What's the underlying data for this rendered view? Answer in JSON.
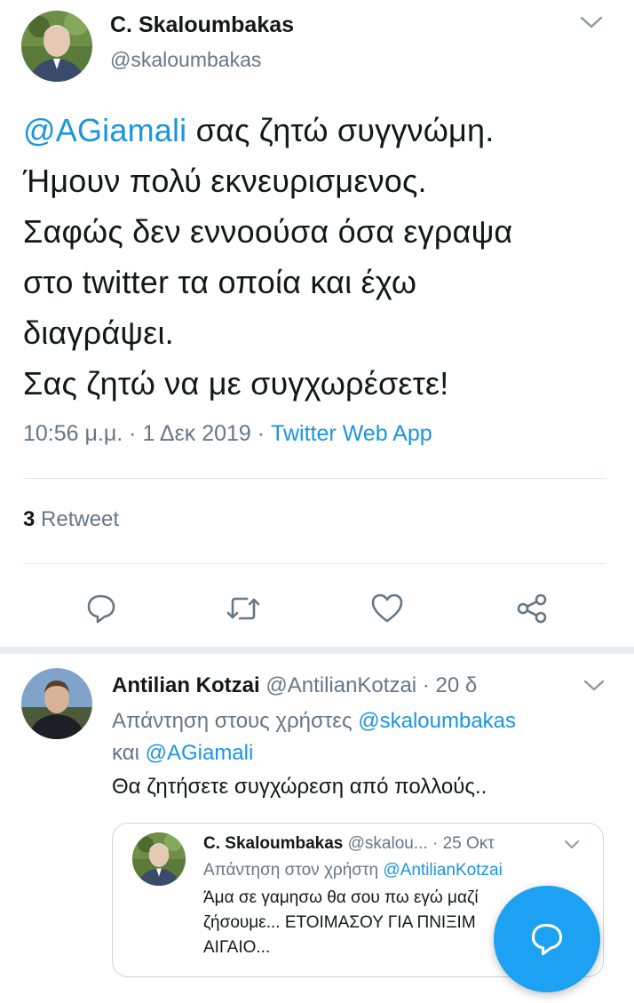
{
  "main_tweet": {
    "author_name": "C. Skaloumbakas",
    "author_handle": "@skaloumbakas",
    "text_lines": [
      {
        "mention": "@AGiamali",
        "rest": " σας ζητώ συγγνώμη."
      },
      {
        "text": "Ήμουν πολύ εκνευρισμενος."
      },
      {
        "text": "Σαφώς δεν εννοούσα όσα εγραψα"
      },
      {
        "text": "στο twitter τα οποία και έχω"
      },
      {
        "text": "διαγράψει."
      },
      {
        "text": "Σας ζητώ να με συγχωρέσετε!"
      }
    ],
    "time": "10:56 μ.μ.",
    "date": "1 Δεκ 2019",
    "separator": "·",
    "source": "Twitter Web App",
    "retweet_count": "3",
    "retweet_label": "Retweet"
  },
  "actions": {
    "reply": "reply-icon",
    "retweet": "retweet-icon",
    "like": "heart-icon",
    "share": "share-icon"
  },
  "reply_tweet": {
    "author_name": "Antilian Kotzai",
    "author_handle": "@AntilianKotzai",
    "separator": "·",
    "time": "20 δ",
    "replying_prefix": "Απάντηση στους χρήστες",
    "replying_mention_1": "@skaloumbakas",
    "replying_conjunction": "και",
    "replying_mention_2": "@AGiamali",
    "text": "Θα ζητήσετε συγχώρεση από πολλούς.."
  },
  "quoted_tweet": {
    "author_name": "C. Skaloumbakas",
    "author_handle": "@skalou...",
    "separator": "·",
    "time": "25 Οκτ",
    "replying_prefix": "Απάντηση στον χρήστη",
    "replying_mention": "@AntilianKotzai",
    "text_lines": [
      "Άμα σε γαμησω θα σου πω εγώ μαζί",
      "ζήσουμε... ΕΤΟΙΜΑΣΟΥ ΓΙΑ ΠΝΙΞΙΜ",
      "ΑΙΓΑΙΟ..."
    ]
  },
  "fab": {
    "icon": "compose-reply-icon"
  },
  "colors": {
    "accent": "#1b95e0",
    "fab": "#1da1f2",
    "secondary_text": "#657786",
    "divider": "#e1e8ed"
  }
}
